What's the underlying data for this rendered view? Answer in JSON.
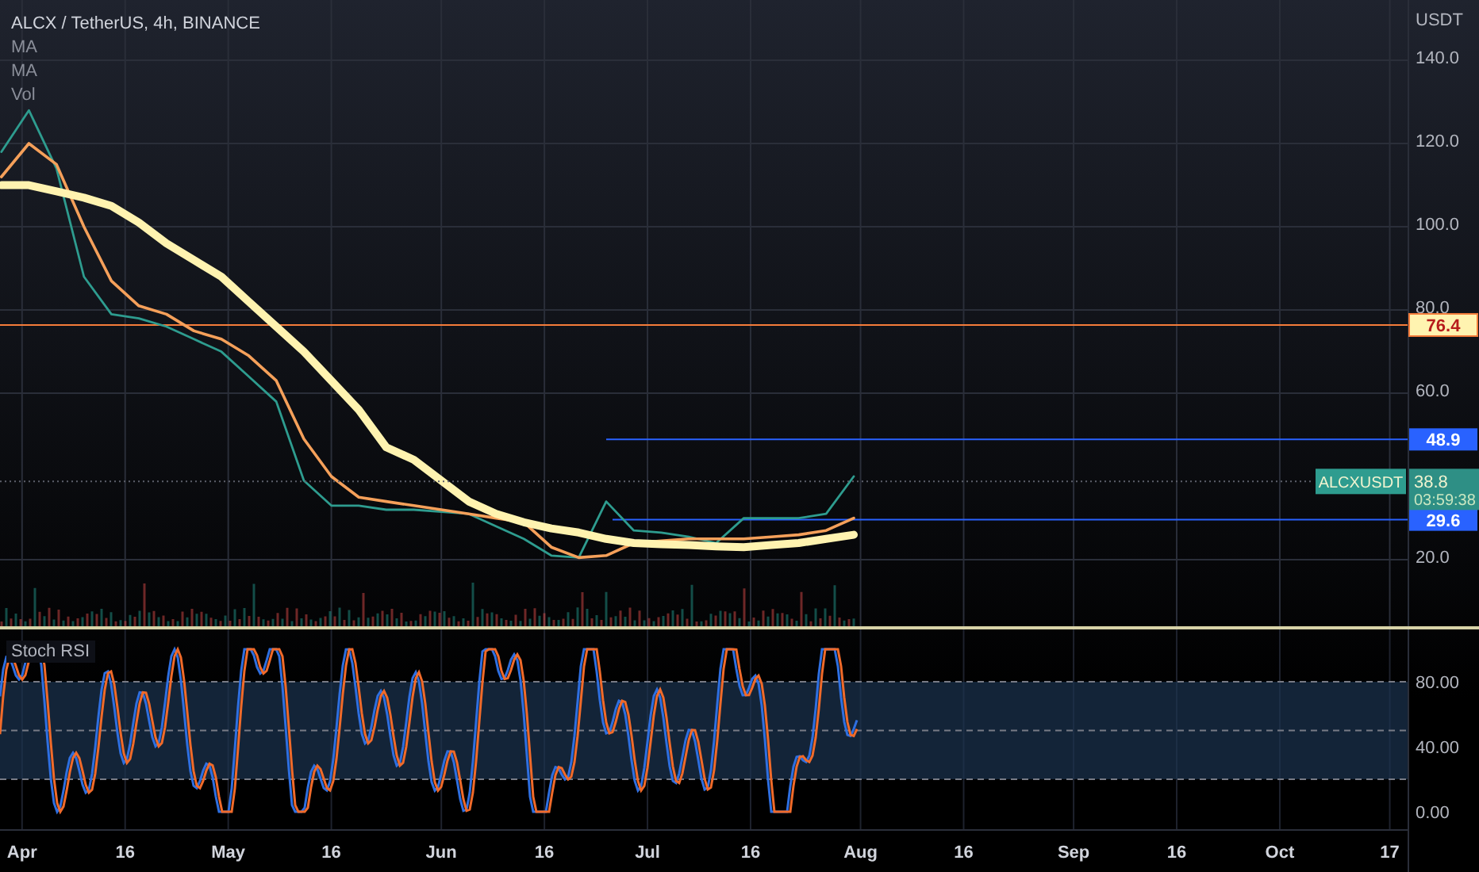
{
  "legend": {
    "title": "ALCX / TetherUS, 4h, BINANCE",
    "indicators": [
      "Vol"
    ]
  },
  "price_pane": {
    "unit": "USDT",
    "chart_data": {
      "type": "line",
      "ylim": [
        4,
        154.5
      ],
      "grid": true,
      "categories": [
        null,
        null,
        null,
        null,
        null,
        null,
        null,
        null,
        null,
        null,
        null,
        null,
        null,
        null,
        null,
        null,
        null,
        null,
        null,
        null,
        null,
        null,
        null,
        null,
        null,
        null,
        null,
        null,
        null,
        null,
        null,
        null
      ],
      "series": [
        {
          "name": "ALCXUSDT",
          "color": "#2e9c8f",
          "values": [
            118,
            128,
            114,
            88,
            79,
            78,
            76,
            73,
            70,
            64,
            58,
            39,
            33,
            33,
            32,
            32,
            31.5,
            31,
            28,
            25,
            21,
            20.5,
            34,
            27,
            26.5,
            25.5,
            24,
            30,
            30,
            30,
            31,
            40
          ]
        },
        {
          "name": "MA",
          "color": "#f5a05a",
          "values": [
            112,
            120,
            115,
            100,
            87,
            81,
            79,
            75,
            73,
            69,
            63,
            49,
            40,
            35,
            34,
            33,
            32,
            31,
            30,
            29,
            23,
            20.5,
            21,
            24,
            24.5,
            25,
            25,
            25,
            25.5,
            26,
            27,
            30
          ]
        },
        {
          "name": "MA",
          "color": "#fff3b0",
          "values": [
            110,
            110,
            108.5,
            107,
            105,
            101,
            96,
            92,
            88,
            82,
            76,
            70,
            63,
            56,
            47,
            44,
            39,
            34,
            31,
            29,
            27.5,
            26.5,
            25,
            24,
            23.7,
            23.5,
            23.2,
            23,
            23.5,
            24,
            25,
            26
          ]
        }
      ],
      "yticks": [
        {
          "value": 140,
          "label": "140.0"
        },
        {
          "value": 120,
          "label": "120.0"
        },
        {
          "value": 100,
          "label": "100.0"
        },
        {
          "value": 80,
          "label": "80.0"
        },
        {
          "value": 60,
          "label": "60.0"
        },
        {
          "value": 20,
          "label": "20.0"
        }
      ],
      "ref_lines": [
        {
          "axis": "y",
          "value": 76.4,
          "label": "76.4",
          "color": "#f57c3a"
        },
        {
          "axis": "y",
          "value": 48.9,
          "label": "48.9",
          "color": "#2962ff"
        },
        {
          "axis": "y",
          "value": 29.6,
          "label": "29.6",
          "color": "#2962ff"
        }
      ]
    },
    "last_price": {
      "price": "38.8",
      "countdown": "03:59:38"
    }
  },
  "stoch_pane": {
    "title": "Stoch RSI",
    "axis_labels": [
      "80.00",
      "40.00",
      "0.00"
    ]
  },
  "time_axis": {
    "labels": [
      "Apr",
      "16",
      "May",
      "16",
      "Jun",
      "16",
      "Jul",
      "16",
      "Aug",
      "16",
      "Sep",
      "16",
      "Oct",
      "17"
    ]
  }
}
